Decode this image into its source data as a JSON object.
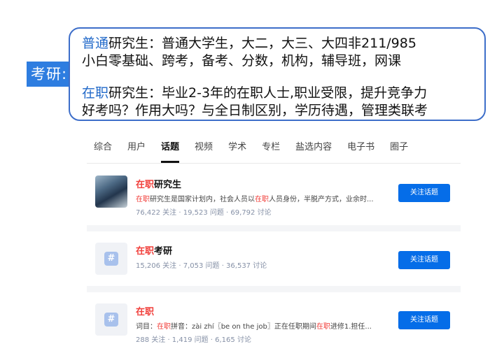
{
  "annotation": {
    "tag": "考研:",
    "line1_hl": "普通",
    "line1_rest": "研究生：普通大学生，大二，大三、大四非211/985",
    "line2": "小白零基础、跨考，备考、分数，机构，辅导班，网课",
    "line3_hl": "在职",
    "line3_rest": "研究生：毕业2-3年的在职人士,职业受限，提升竞争力",
    "line4": "好考吗？作用大吗？与全日制区别，学历待遇，管理类联考"
  },
  "tabs": [
    {
      "label": "综合"
    },
    {
      "label": "用户"
    },
    {
      "label": "话题",
      "active": true
    },
    {
      "label": "视频"
    },
    {
      "label": "学术"
    },
    {
      "label": "专栏"
    },
    {
      "label": "盐选内容"
    },
    {
      "label": "电子书"
    },
    {
      "label": "圈子"
    }
  ],
  "results": [
    {
      "title_hl": "在职",
      "title_rest": "研究生",
      "desc_parts": [
        "",
        "在职",
        "研究生是国家计划内，社会人员以",
        "在职",
        "人员身份，半脱产方式，业余时..."
      ],
      "meta": "76,422 关注 · 19,523 问题 · 69,792 讨论",
      "button": "关注话题",
      "thumb": "photo-thumbnail"
    },
    {
      "title_hl": "在职",
      "title_rest": "考研",
      "meta": "15,206 关注 · 7,053 问题 · 36,537 讨论",
      "button": "关注话题",
      "thumb": "hash-icon"
    },
    {
      "title_hl": "在职",
      "title_rest": "",
      "desc_parts": [
        "词目：",
        "在职",
        "拼音：zài zhí〖be on the job〗正在任职期间",
        "在职",
        "进修1.担任..."
      ],
      "meta": "288 关注 · 1,419 问题 · 6,165 讨论",
      "button": "关注话题",
      "thumb": "hash-icon"
    }
  ],
  "colors": {
    "accent": "#056de8",
    "highlight": "#f1403c",
    "annotation_blue": "#2e7de0"
  }
}
